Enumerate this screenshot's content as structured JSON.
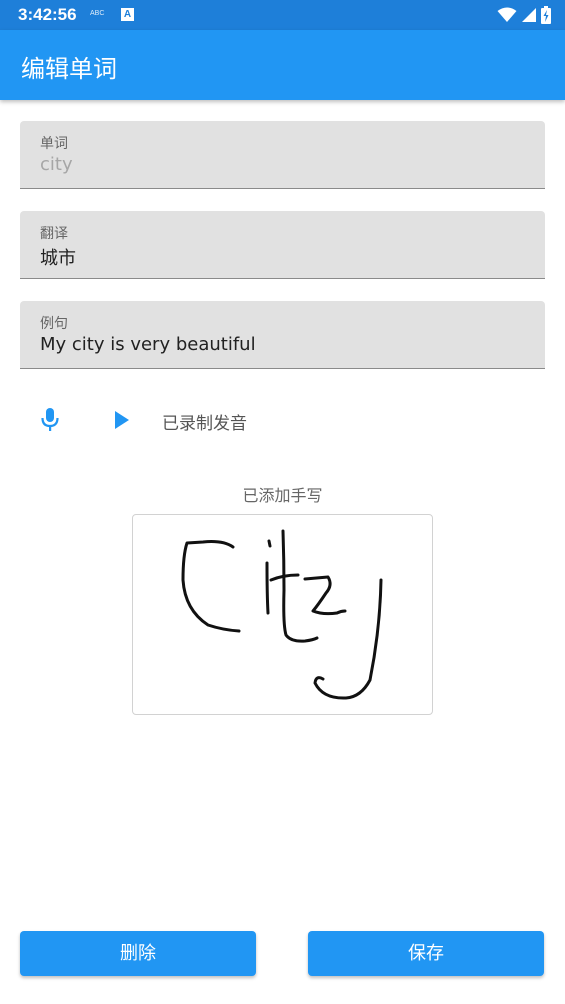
{
  "status_bar": {
    "time": "3:42:56",
    "abc_badge": "ABC",
    "notification_icon": "A"
  },
  "app_bar": {
    "title": "编辑单词"
  },
  "form": {
    "word": {
      "label": "单词",
      "value": "city"
    },
    "translation": {
      "label": "翻译",
      "value": "城市"
    },
    "example": {
      "label": "例句",
      "value": "My city is very beautiful"
    }
  },
  "audio": {
    "mic_icon": "mic-icon",
    "play_icon": "play-icon",
    "status": "已录制发音"
  },
  "handwriting": {
    "label": "已添加手写",
    "written_word": "city"
  },
  "actions": {
    "delete_label": "删除",
    "save_label": "保存"
  },
  "colors": {
    "primary": "#2196f3",
    "status_bar": "#1e7fd9",
    "field_bg": "#e1e1e1"
  }
}
